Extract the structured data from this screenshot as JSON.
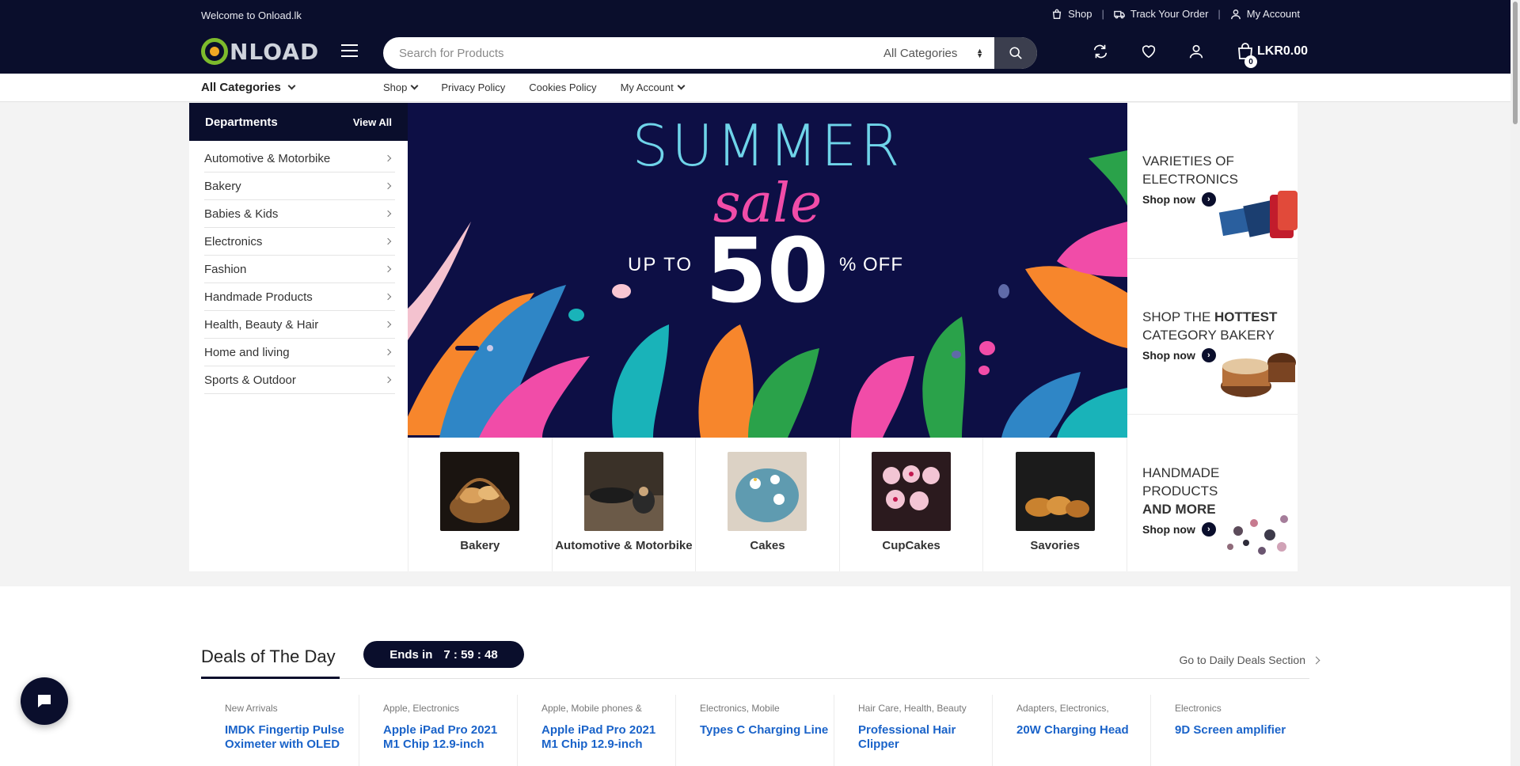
{
  "header": {
    "welcome": "Welcome to Onload.lk",
    "links": [
      {
        "label": "Shop",
        "icon": "bag-icon"
      },
      {
        "label": "Track Your Order",
        "icon": "truck-icon"
      },
      {
        "label": "My Account",
        "icon": "user-icon"
      }
    ],
    "logo_text": "NLOAD",
    "search_placeholder": "Search for Products",
    "search_category": "All Categories",
    "cart_count": "0",
    "cart_total": "LKR0.00"
  },
  "nav": {
    "all_categories": "All Categories",
    "items": [
      {
        "label": "Shop",
        "has_dropdown": true
      },
      {
        "label": "Privacy Policy",
        "has_dropdown": false
      },
      {
        "label": "Cookies Policy",
        "has_dropdown": false
      },
      {
        "label": "My Account",
        "has_dropdown": true
      }
    ]
  },
  "departments": {
    "title": "Departments",
    "view_all": "View All",
    "items": [
      "Automotive & Motorbike",
      "Bakery",
      "Babies & Kids",
      "Electronics",
      "Fashion",
      "Handmade Products",
      "Health, Beauty & Hair",
      "Home and living",
      "Sports & Outdoor"
    ]
  },
  "banner": {
    "line1": "SUMMER",
    "line2": "sale",
    "up_to": "UP TO",
    "value": "50",
    "suffix": "% OFF"
  },
  "side_cards": [
    {
      "title_plain": "VARIETIES OF ELECTRONICS",
      "title_bold": "",
      "shop": "Shop now"
    },
    {
      "title_plain": "SHOP THE",
      "title_bold": "HOTTEST",
      "title_tail": "CATEGORY BAKERY",
      "shop": "Shop now"
    },
    {
      "title_plain": "HANDMADE PRODUCTS",
      "title_bold": "AND MORE",
      "shop": "Shop now"
    }
  ],
  "categories": [
    "Bakery",
    "Automotive & Motorbike",
    "Cakes",
    "CupCakes",
    "Savories"
  ],
  "deals": {
    "title": "Deals of The Day",
    "ends_label": "Ends in",
    "countdown": "7 : 59 : 48",
    "link": "Go to Daily Deals Section",
    "products": [
      {
        "cats": "New Arrivals",
        "name": "IMDK Fingertip Pulse Oximeter with OLED"
      },
      {
        "cats": "Apple, Electronics",
        "name": "Apple iPad Pro 2021 M1 Chip 12.9-inch"
      },
      {
        "cats": "Apple, Mobile phones &",
        "name": "Apple iPad Pro 2021 M1 Chip 12.9-inch"
      },
      {
        "cats": "Electronics, Mobile",
        "name": "Types C Charging Line"
      },
      {
        "cats": "Hair Care, Health, Beauty",
        "name": "Professional Hair Clipper"
      },
      {
        "cats": "Adapters, Electronics,",
        "name": "20W Charging Head"
      },
      {
        "cats": "Electronics",
        "name": "9D Screen amplifier"
      }
    ]
  },
  "colors": {
    "primary": "#0a0e2c",
    "link_blue": "#1a63c9",
    "banner_bg": "#0d0f45",
    "summer": "#6fd4e9",
    "sale": "#f14ca8"
  }
}
